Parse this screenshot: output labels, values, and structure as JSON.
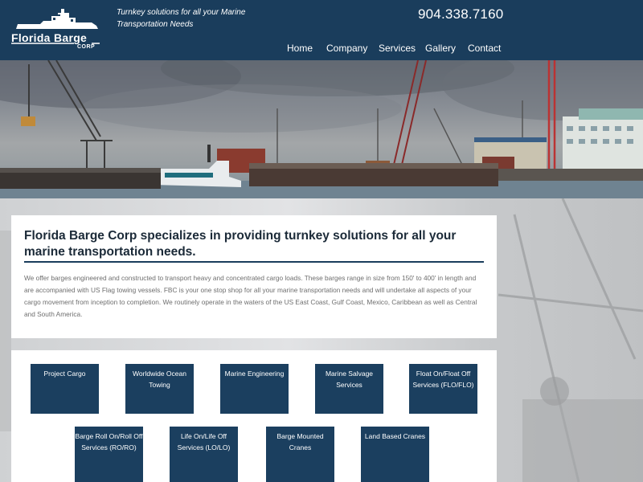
{
  "header": {
    "logo_text": "Florida Barge",
    "logo_subtext": "CORP",
    "tagline": "Turnkey solutions for all your Marine Transportation Needs",
    "phone": "904.338.7160"
  },
  "nav": {
    "items": [
      {
        "label": "Home"
      },
      {
        "label": "Company"
      },
      {
        "label": "Services"
      },
      {
        "label": "Gallery"
      },
      {
        "label": "Contact"
      }
    ]
  },
  "intro": {
    "title": "Florida Barge Corp specializes in providing turnkey solutions for all your marine transportation needs.",
    "body": "We offer barges engineered and constructed to transport heavy and concentrated cargo loads. These barges range in size from 150' to 400' in length and are accompanied with US Flag towing vessels. FBC is your one stop shop for all your marine transportation needs and will undertake all aspects of your cargo movement from inception to completion. We routinely operate in the waters of the US East Coast, Gulf Coast, Mexico, Caribbean as well as Central and South America."
  },
  "services": [
    {
      "label": "Project Cargo"
    },
    {
      "label": "Worldwide Ocean Towing"
    },
    {
      "label": "Marine Engineering"
    },
    {
      "label": "Marine Salvage Services"
    },
    {
      "label": "Float On/Float Off Services (FLO/FLO)"
    },
    {
      "label": "Barge Roll On/Roll Off Services (RO/RO)"
    },
    {
      "label": "Life On/Life Off Services (LO/LO)"
    },
    {
      "label": "Barge Mounted Cranes"
    },
    {
      "label": "Land Based Cranes"
    }
  ],
  "colors": {
    "header_bg": "#1a3d5c",
    "button_bg": "#1b3f5f",
    "title_text": "#1b2a38",
    "body_text": "#6e6e6e"
  },
  "icons": {
    "logo": "tugboat-logo"
  }
}
